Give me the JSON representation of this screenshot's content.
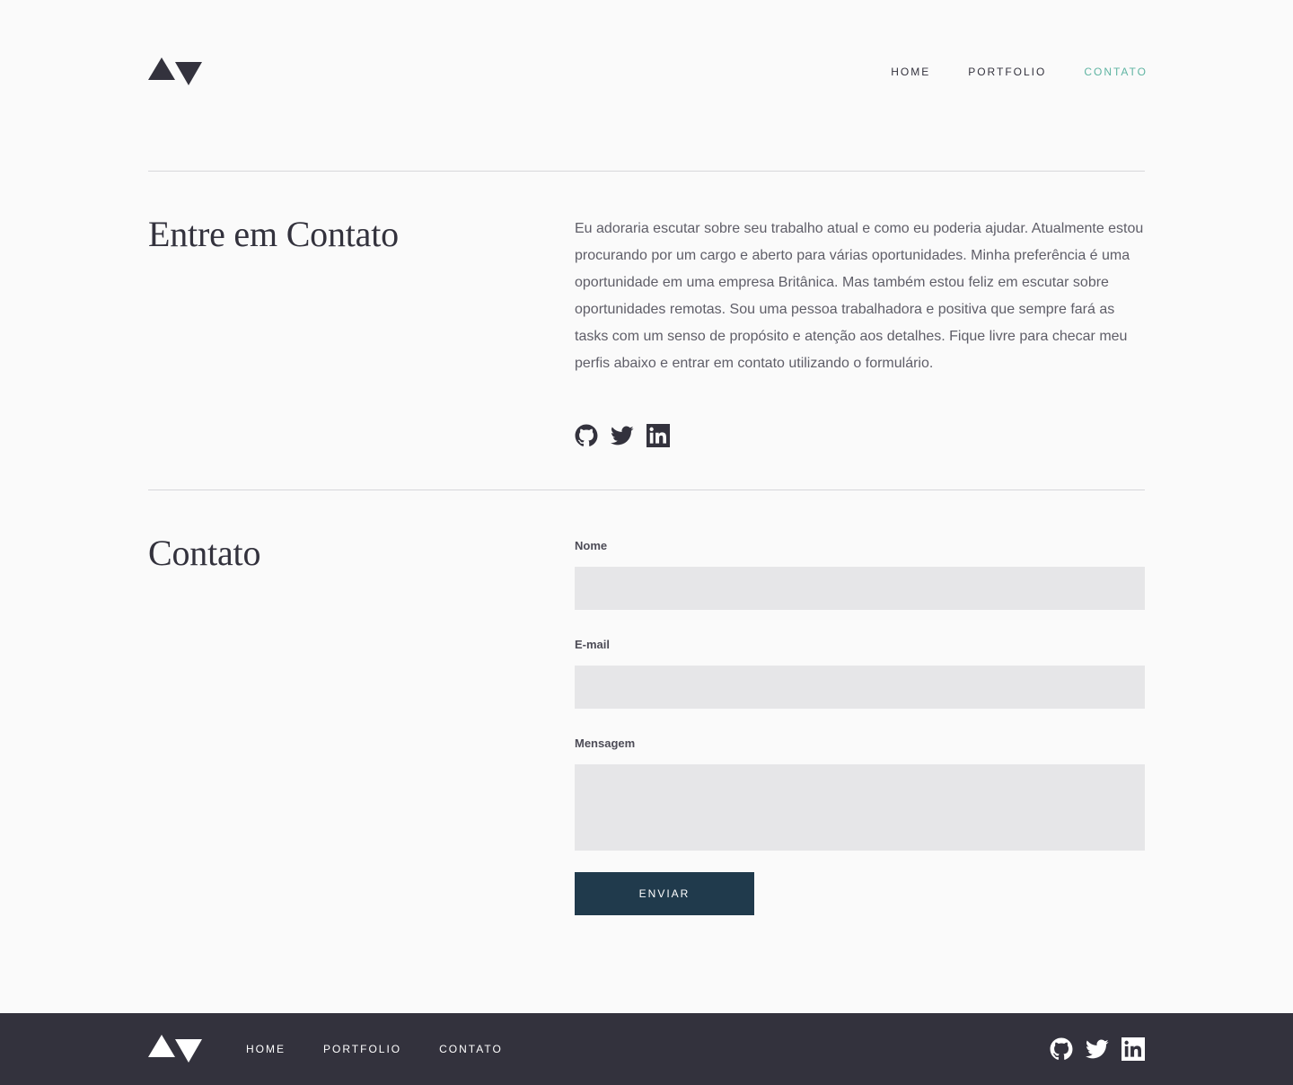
{
  "header": {
    "nav": [
      {
        "label": "HOME"
      },
      {
        "label": "PORTFOLIO"
      },
      {
        "label": "CONTATO"
      }
    ]
  },
  "intro": {
    "title": "Entre em Contato",
    "text": "Eu adoraria escutar sobre seu trabalho atual e como eu poderia ajudar. Atualmente estou procurando por um cargo e aberto para várias oportunidades. Minha preferência é uma oportunidade em uma empresa Britânica. Mas também estou feliz em escutar sobre oportunidades remotas. Sou uma pessoa trabalhadora e positiva que sempre fará as tasks com um senso de propósito e atenção aos detalhes. Fique livre para checar meu perfis abaixo e entrar em contato utilizando o formulário."
  },
  "socials": [
    "github-icon",
    "twitter-icon",
    "linkedin-icon"
  ],
  "contact": {
    "title": "Contato",
    "fields": {
      "name_label": "Nome",
      "name_value": "",
      "email_label": "E-mail",
      "email_value": "",
      "message_label": "Mensagem",
      "message_value": ""
    },
    "submit_label": "ENVIAR"
  },
  "footer": {
    "nav": [
      {
        "label": "HOME"
      },
      {
        "label": "PORTFOLIO"
      },
      {
        "label": "CONTATO"
      }
    ]
  },
  "colors": {
    "background": "#fafafa",
    "text_dark": "#33323d",
    "accent": "#5fb4a2",
    "input_bg": "#e6e6e8",
    "button_bg": "#203a4c",
    "footer_bg": "#33323d"
  }
}
